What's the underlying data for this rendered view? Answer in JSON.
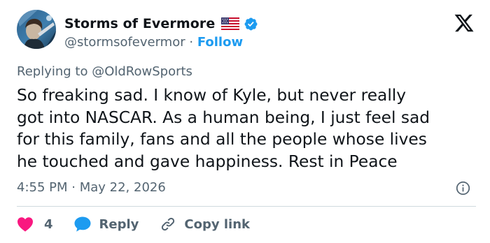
{
  "author": {
    "display_name": "Storms of Evermore",
    "handle": "@stormsofevermor",
    "separator": "·",
    "follow_label": "Follow",
    "flag_icon": "us-flag-icon",
    "verified_icon": "verified-badge-icon",
    "verified_color": "#1d9bf0"
  },
  "brand": {
    "logo_icon": "x-logo-icon"
  },
  "reply_context": "Replying to @OldRowSports",
  "tweet": {
    "lines": [
      "So freaking sad. I know of Kyle, but never really",
      "got into NASCAR. As a human being, I just feel sad",
      "for this family, fans and all the people whose lives",
      "he touched and gave happiness. Rest in Peace"
    ]
  },
  "meta": {
    "time": "4:55 PM",
    "separator": "·",
    "date": "May 22, 2026",
    "info_icon": "info-icon"
  },
  "actions": {
    "like_count": "4",
    "like_color": "#f91880",
    "reply_label": "Reply",
    "reply_color": "#1d9bf0",
    "copy_link_label": "Copy link"
  }
}
